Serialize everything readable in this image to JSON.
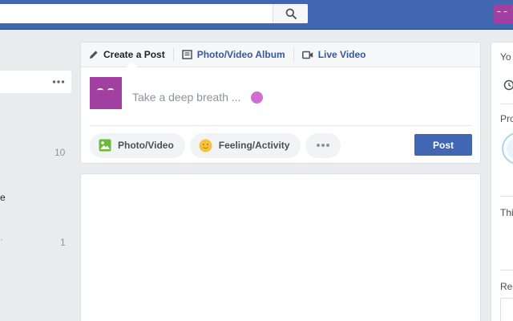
{
  "topbar": {
    "search_placeholder": "",
    "search_icon": "magnifier-icon",
    "brand_color": "#4267b2"
  },
  "left_nav": {
    "counts": [
      "10",
      "1"
    ],
    "text_fragment": "e",
    "more_icon": "ellipsis-icon"
  },
  "composer": {
    "tabs": [
      {
        "label": "Create a Post",
        "icon": "pencil-icon"
      },
      {
        "label": "Photo/Video Album",
        "icon": "album-icon"
      },
      {
        "label": "Live Video",
        "icon": "video-camera-icon"
      }
    ],
    "placeholder": "Take a deep breath ...",
    "actions": [
      {
        "label": "Photo/Video",
        "icon": "photo-icon",
        "color": "#6bba3c"
      },
      {
        "label": "Feeling/Activity",
        "icon": "smiley-icon",
        "color": "#f5c33b"
      }
    ],
    "post_label": "Post",
    "avatar_color": "#a140a0",
    "emoji_color": "#cf6dd1"
  },
  "right_col": {
    "headings": [
      "Yo",
      "Pro",
      "Thi",
      "Rec"
    ]
  }
}
